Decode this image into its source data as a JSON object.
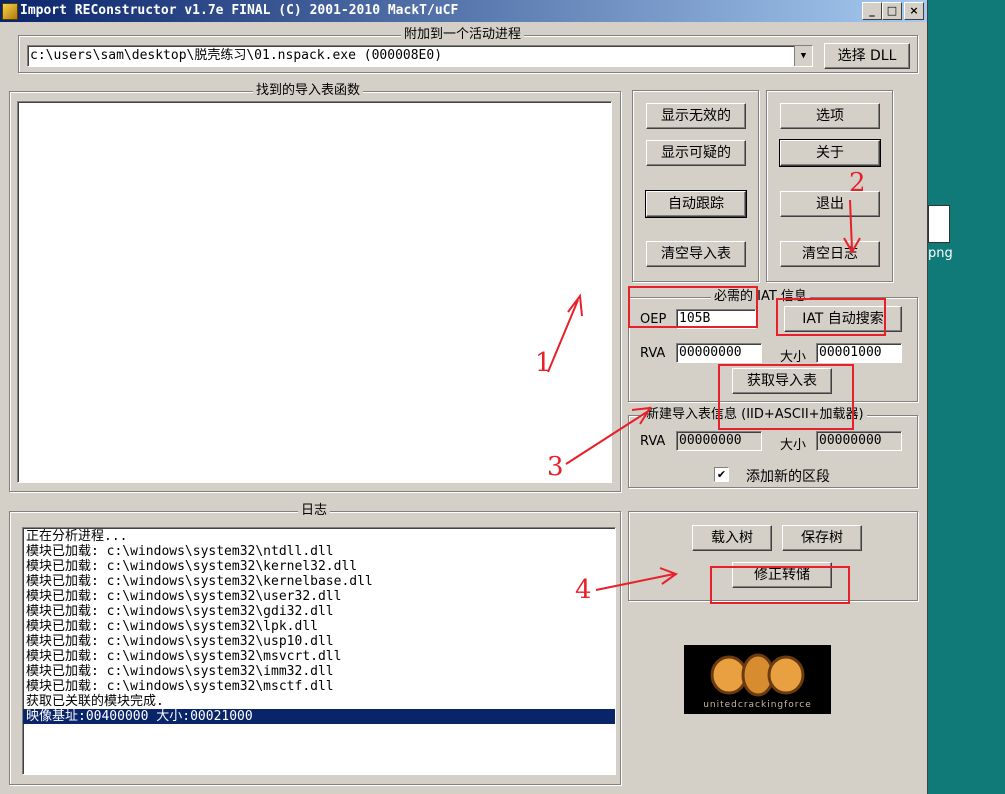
{
  "window": {
    "title": "Import REConstructor v1.7e FINAL (C) 2001-2010 MackT/uCF",
    "min_glyph": "_",
    "max_glyph": "□",
    "close_glyph": "×"
  },
  "attach": {
    "group_title": "附加到一个活动进程",
    "process_value": "c:\\users\\sam\\desktop\\脱壳练习\\01.nspack.exe (000008E0)",
    "pick_dll_label": "选择 DLL"
  },
  "imports": {
    "group_title": "找到的导入表函数"
  },
  "buttons": {
    "show_invalid": "显示无效的",
    "show_suspect": "显示可疑的",
    "auto_trace": "自动跟踪",
    "clear_imports": "清空导入表",
    "options": "选项",
    "about": "关于",
    "exit": "退出",
    "clear_log": "清空日志"
  },
  "iat": {
    "group_title": "必需的 IAT 信息",
    "oep_label": "OEP",
    "oep_value": "105B",
    "auto_search_label": "IAT 自动搜索",
    "rva_label": "RVA",
    "rva_value": "00000000",
    "size_label": "大小",
    "size_value": "00001000",
    "get_imports_label": "获取导入表"
  },
  "new_imports": {
    "group_title": "新建导入表信息 (IID+ASCII+加载器)",
    "rva_label": "RVA",
    "rva_value": "00000000",
    "size_label": "大小",
    "size_value": "00000000",
    "add_section_label": "添加新的区段",
    "add_section_checked": true
  },
  "log": {
    "group_title": "日志",
    "lines": [
      "正在分析进程...",
      "模块已加载: c:\\windows\\system32\\ntdll.dll",
      "模块已加载: c:\\windows\\system32\\kernel32.dll",
      "模块已加载: c:\\windows\\system32\\kernelbase.dll",
      "模块已加载: c:\\windows\\system32\\user32.dll",
      "模块已加载: c:\\windows\\system32\\gdi32.dll",
      "模块已加载: c:\\windows\\system32\\lpk.dll",
      "模块已加载: c:\\windows\\system32\\usp10.dll",
      "模块已加载: c:\\windows\\system32\\msvcrt.dll",
      "模块已加载: c:\\windows\\system32\\imm32.dll",
      "模块已加载: c:\\windows\\system32\\msctf.dll",
      "获取已关联的模块完成.",
      "映像基址:00400000 大小:00021000"
    ],
    "selected_index": 12
  },
  "tree": {
    "load_label": "载入树",
    "save_label": "保存树",
    "fix_dump_label": "修正转储"
  },
  "logo": {
    "text": "unitedcrackingforce"
  },
  "annotations": [
    "1",
    "2",
    "3",
    "4"
  ],
  "desktop": {
    "icon_label": "png"
  },
  "colors": {
    "annotation_red": "#e8202a",
    "selection_blue": "#0a246a",
    "desktop_teal": "#0f7a78"
  }
}
